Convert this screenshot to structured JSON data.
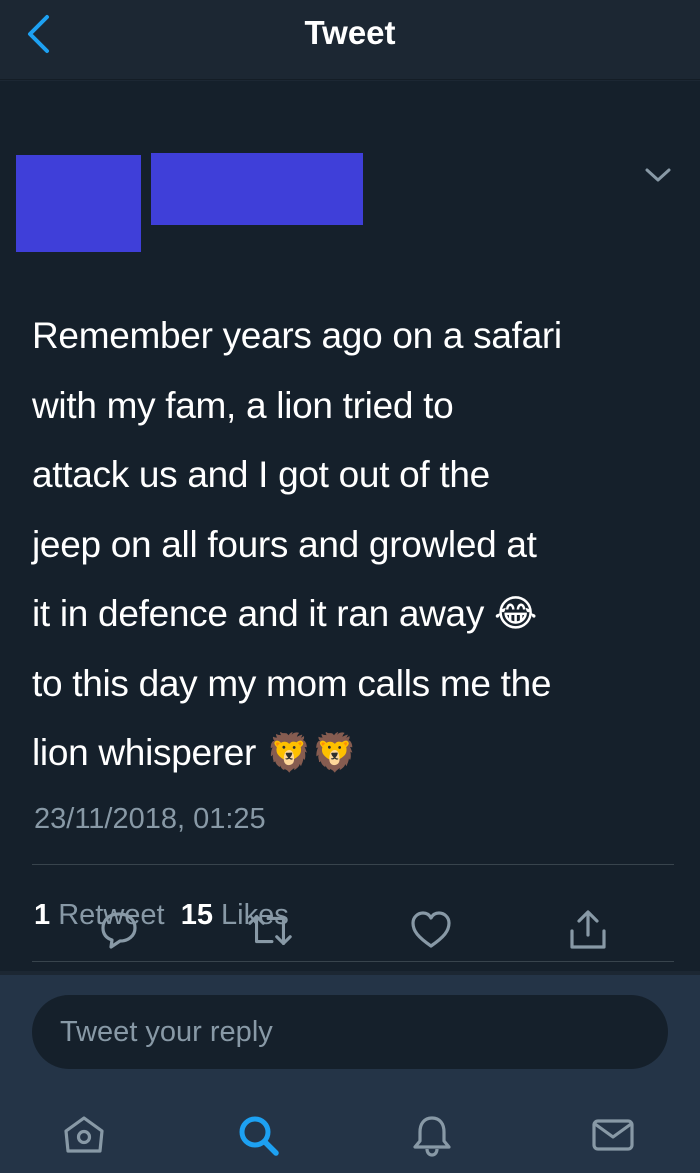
{
  "header": {
    "title": "Tweet",
    "back_icon": "chevron-left-icon"
  },
  "tweet": {
    "text": "Remember years ago on a safari\nwith my fam, a lion tried to\nattack us and I got out of the\njeep on all fours and growled at\nit in defence and it ran away 😂\nto this day my mom calls me the\nlion whisperer 🦁🦁",
    "timestamp": "23/11/2018, 01:25",
    "retweet_count": "1",
    "retweet_label": "Retweet",
    "like_count": "15",
    "like_label": "Likes"
  },
  "actions": [
    "reply-icon",
    "retweet-icon",
    "heart-icon",
    "share-icon"
  ],
  "reply": {
    "placeholder": "Tweet your reply"
  },
  "tabs": [
    "home-icon",
    "search-icon",
    "bell-icon",
    "mail-icon"
  ],
  "colors": {
    "accent": "#1da1f2",
    "background": "#15202b",
    "header": "#1c2733",
    "secondary_text": "#8899a6",
    "redaction": "#3f3fd9"
  }
}
